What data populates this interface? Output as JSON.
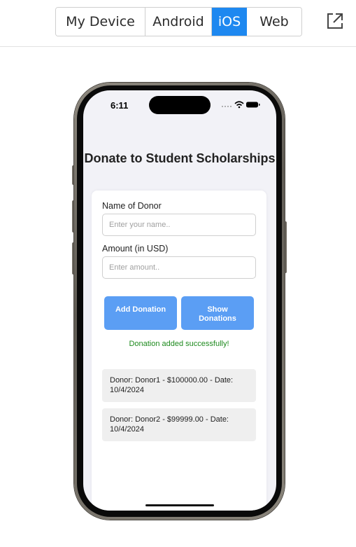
{
  "platform_tabs": [
    {
      "label": "My Device"
    },
    {
      "label": "Android"
    },
    {
      "label": "iOS",
      "active": true
    },
    {
      "label": "Web"
    }
  ],
  "colors": {
    "active_tab": "#1e88f0",
    "button": "#5b9ef4",
    "success_text": "#1e8a1e"
  },
  "phone": {
    "status_time": "6:11"
  },
  "app": {
    "title": "Donate to Student Scholarships",
    "donor_label": "Name of Donor",
    "donor_placeholder": "Enter your name..",
    "amount_label": "Amount (in USD)",
    "amount_placeholder": "Enter amount..",
    "add_button": "Add Donation",
    "show_button": "Show Donations",
    "success_message": "Donation added successfully!",
    "donations": [
      "Donor: Donor1 - $100000.00 - Date: 10/4/2024",
      "Donor: Donor2 - $99999.00 - Date: 10/4/2024"
    ]
  }
}
